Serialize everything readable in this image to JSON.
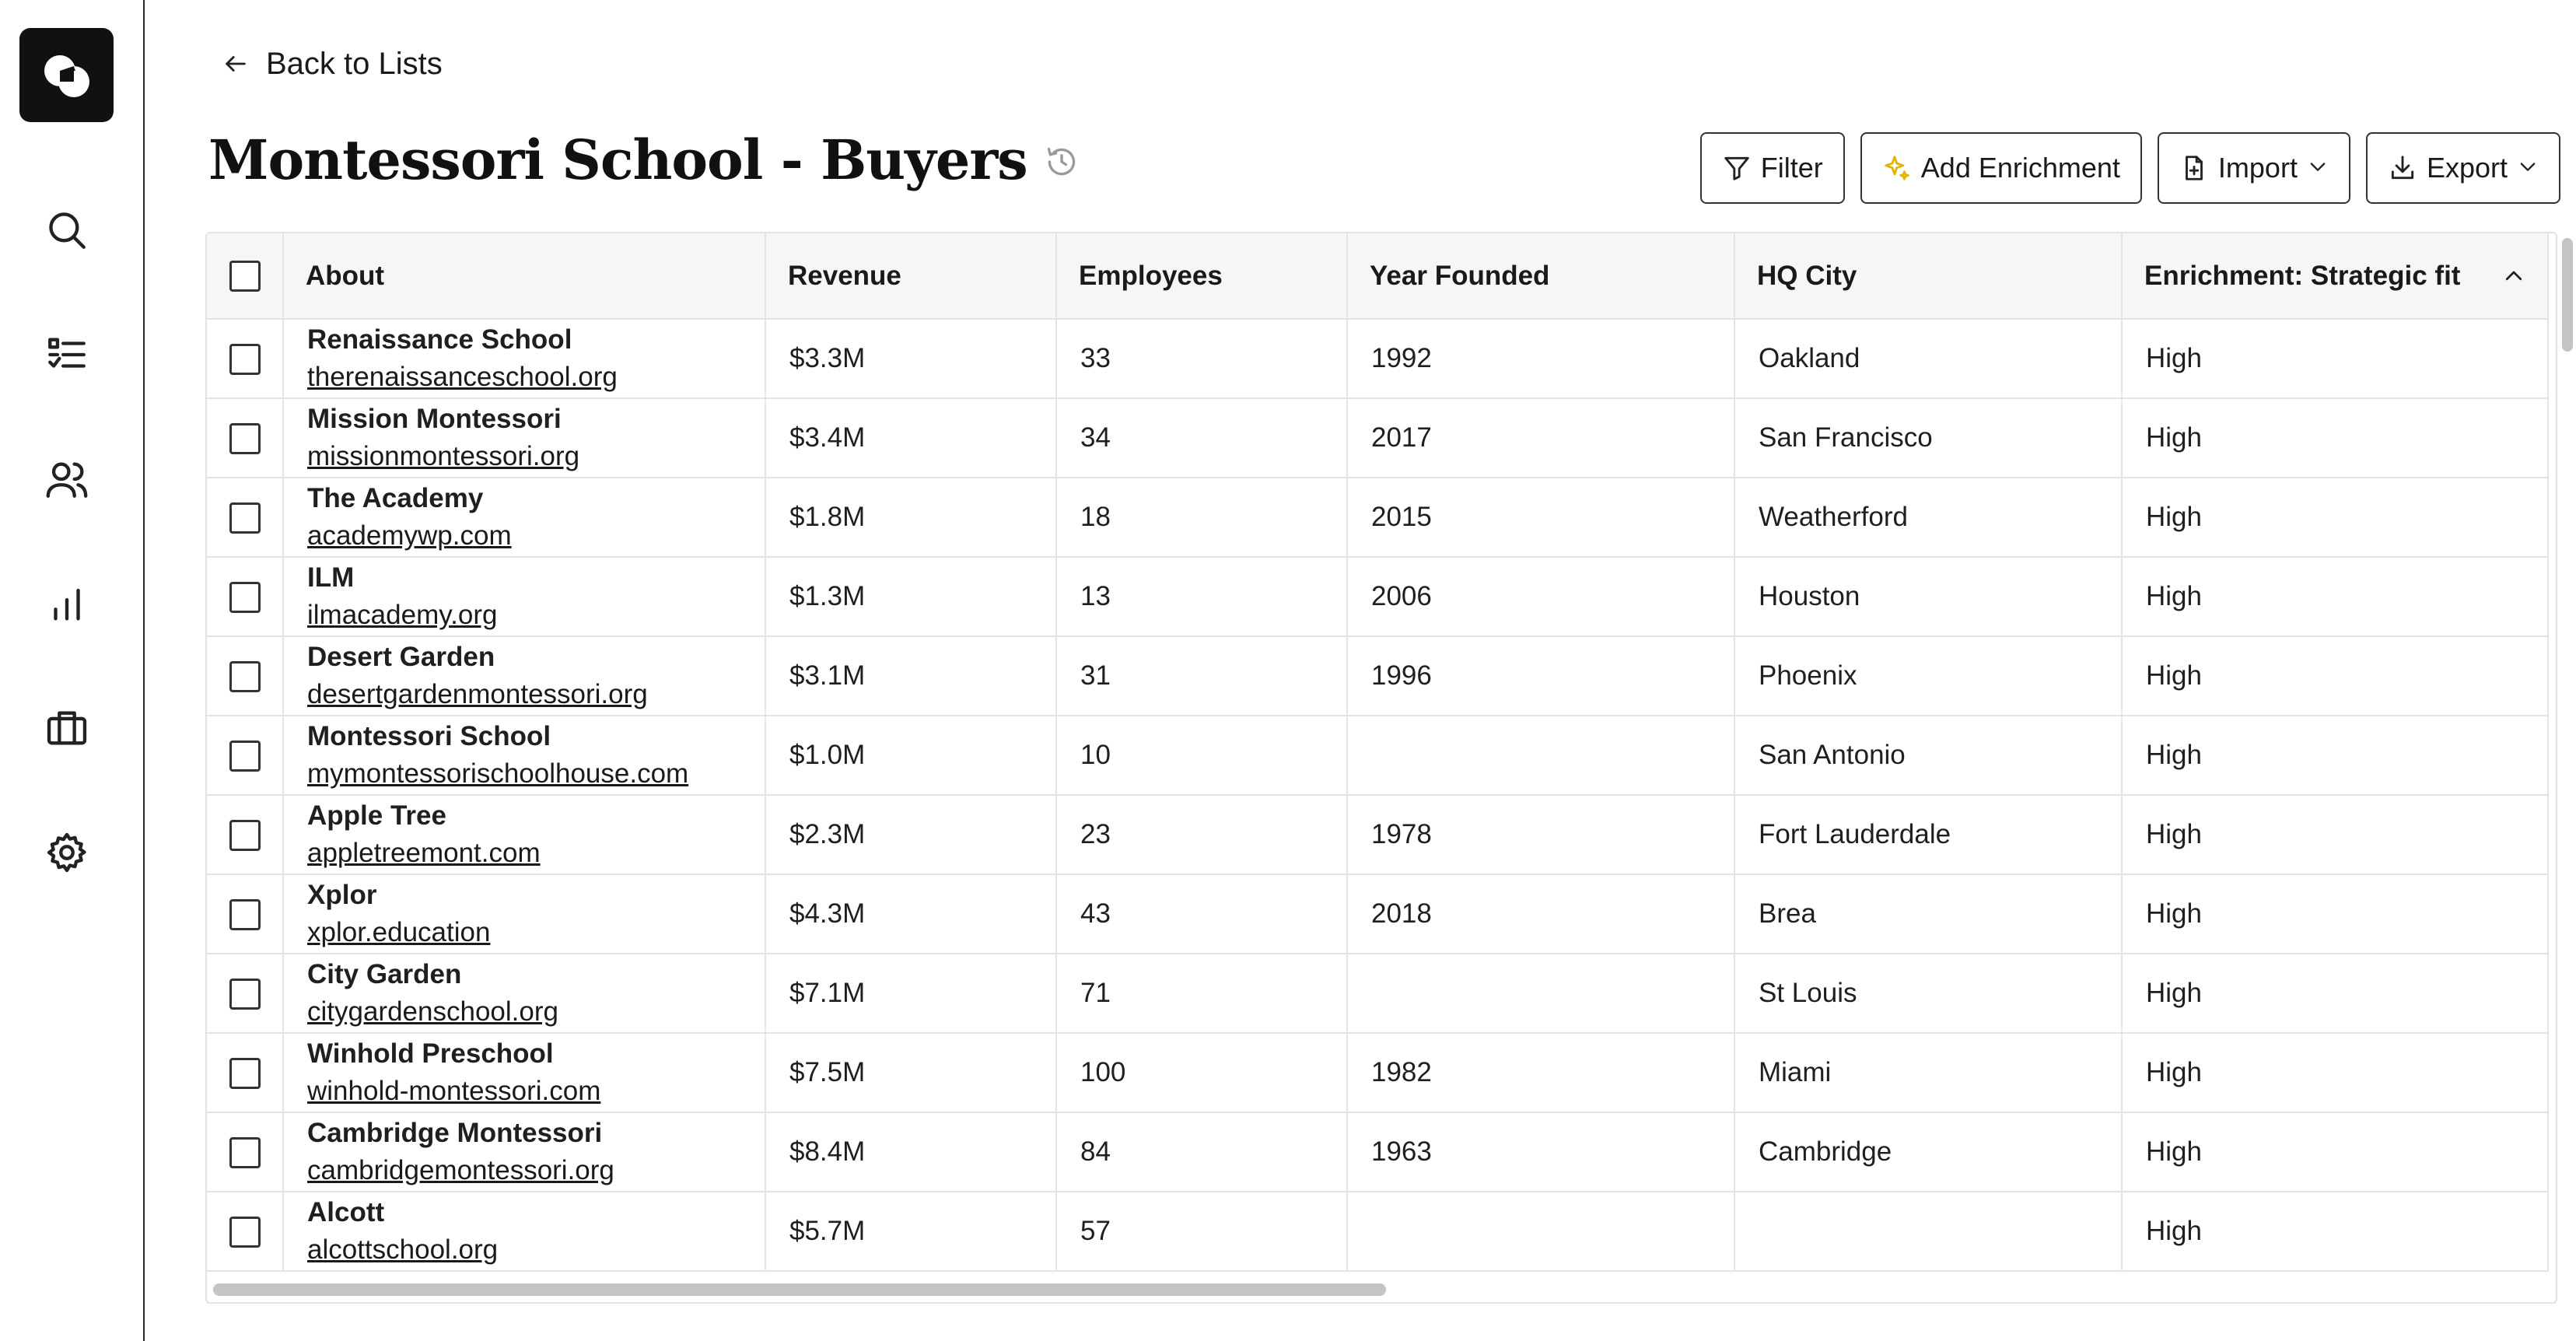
{
  "sidebar": {
    "items": [
      {
        "name": "search",
        "icon": "search-icon"
      },
      {
        "name": "lists",
        "icon": "checklist-icon"
      },
      {
        "name": "people",
        "icon": "users-icon"
      },
      {
        "name": "analytics",
        "icon": "bar-chart-icon"
      },
      {
        "name": "deals",
        "icon": "briefcase-icon"
      },
      {
        "name": "settings",
        "icon": "gear-icon"
      }
    ]
  },
  "header": {
    "back_label": "Back to Lists",
    "title": "Montessori School - Buyers"
  },
  "toolbar": {
    "filter_label": "Filter",
    "enrichment_label": "Add Enrichment",
    "import_label": "Import",
    "export_label": "Export"
  },
  "colors": {
    "accent_sparkle": "#e0b400"
  },
  "table": {
    "columns": [
      "About",
      "Revenue",
      "Employees",
      "Year Founded",
      "HQ City",
      "Enrichment: Strategic fit"
    ],
    "rows": [
      {
        "name": "Renaissance School",
        "domain": "therenaissanceschool.org",
        "revenue": "$3.3M",
        "employees": "33",
        "year": "1992",
        "city": "Oakland",
        "fit": "High"
      },
      {
        "name": "Mission Montessori",
        "domain": "missionmontessori.org",
        "revenue": "$3.4M",
        "employees": "34",
        "year": "2017",
        "city": "San Francisco",
        "fit": "High"
      },
      {
        "name": "The Academy",
        "domain": "academywp.com",
        "revenue": "$1.8M",
        "employees": "18",
        "year": "2015",
        "city": "Weatherford",
        "fit": "High"
      },
      {
        "name": "ILM",
        "domain": "ilmacademy.org",
        "revenue": "$1.3M",
        "employees": "13",
        "year": "2006",
        "city": "Houston",
        "fit": "High"
      },
      {
        "name": "Desert Garden",
        "domain": "desertgardenmontessori.org",
        "revenue": "$3.1M",
        "employees": "31",
        "year": "1996",
        "city": "Phoenix",
        "fit": "High"
      },
      {
        "name": "Montessori School",
        "domain": "mymontessorischoolhouse.com",
        "revenue": "$1.0M",
        "employees": "10",
        "year": "",
        "city": "San Antonio",
        "fit": "High"
      },
      {
        "name": "Apple Tree",
        "domain": "appletreemont.com",
        "revenue": "$2.3M",
        "employees": "23",
        "year": "1978",
        "city": "Fort Lauderdale",
        "fit": "High"
      },
      {
        "name": "Xplor",
        "domain": "xplor.education",
        "revenue": "$4.3M",
        "employees": "43",
        "year": "2018",
        "city": "Brea",
        "fit": "High"
      },
      {
        "name": "City Garden",
        "domain": "citygardenschool.org",
        "revenue": "$7.1M",
        "employees": "71",
        "year": "",
        "city": "St Louis",
        "fit": "High"
      },
      {
        "name": "Winhold Preschool",
        "domain": "winhold-montessori.com",
        "revenue": "$7.5M",
        "employees": "100",
        "year": "1982",
        "city": "Miami",
        "fit": "High"
      },
      {
        "name": "Cambridge Montessori",
        "domain": "cambridgemontessori.org",
        "revenue": "$8.4M",
        "employees": "84",
        "year": "1963",
        "city": "Cambridge",
        "fit": "High"
      },
      {
        "name": "Alcott",
        "domain": "alcottschool.org",
        "revenue": "$5.7M",
        "employees": "57",
        "year": "",
        "city": "",
        "fit": "High"
      }
    ]
  }
}
